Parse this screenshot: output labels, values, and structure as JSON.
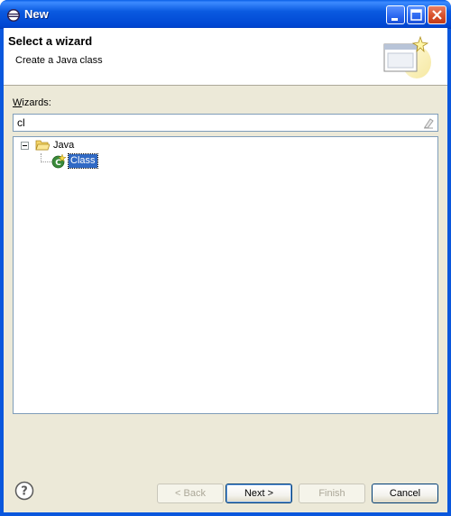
{
  "window": {
    "title": "New"
  },
  "header": {
    "title": "Select a wizard",
    "description": "Create a Java class"
  },
  "wizards": {
    "label_prefix": "W",
    "label_rest": "izards:",
    "filter_value": "cl"
  },
  "tree": {
    "folder_label": "Java",
    "item_label": "Class"
  },
  "buttons": {
    "back": "< Back",
    "next": "Next >",
    "finish": "Finish",
    "cancel": "Cancel"
  },
  "icons": {
    "title": "eclipse-icon",
    "minimize": "minimize-icon",
    "maximize": "maximize-icon",
    "close": "close-icon",
    "wizard_banner": "wizard-banner-icon",
    "clear": "clear-filter-icon",
    "folder": "folder-open-icon",
    "class": "java-class-icon",
    "help": "help-icon"
  }
}
